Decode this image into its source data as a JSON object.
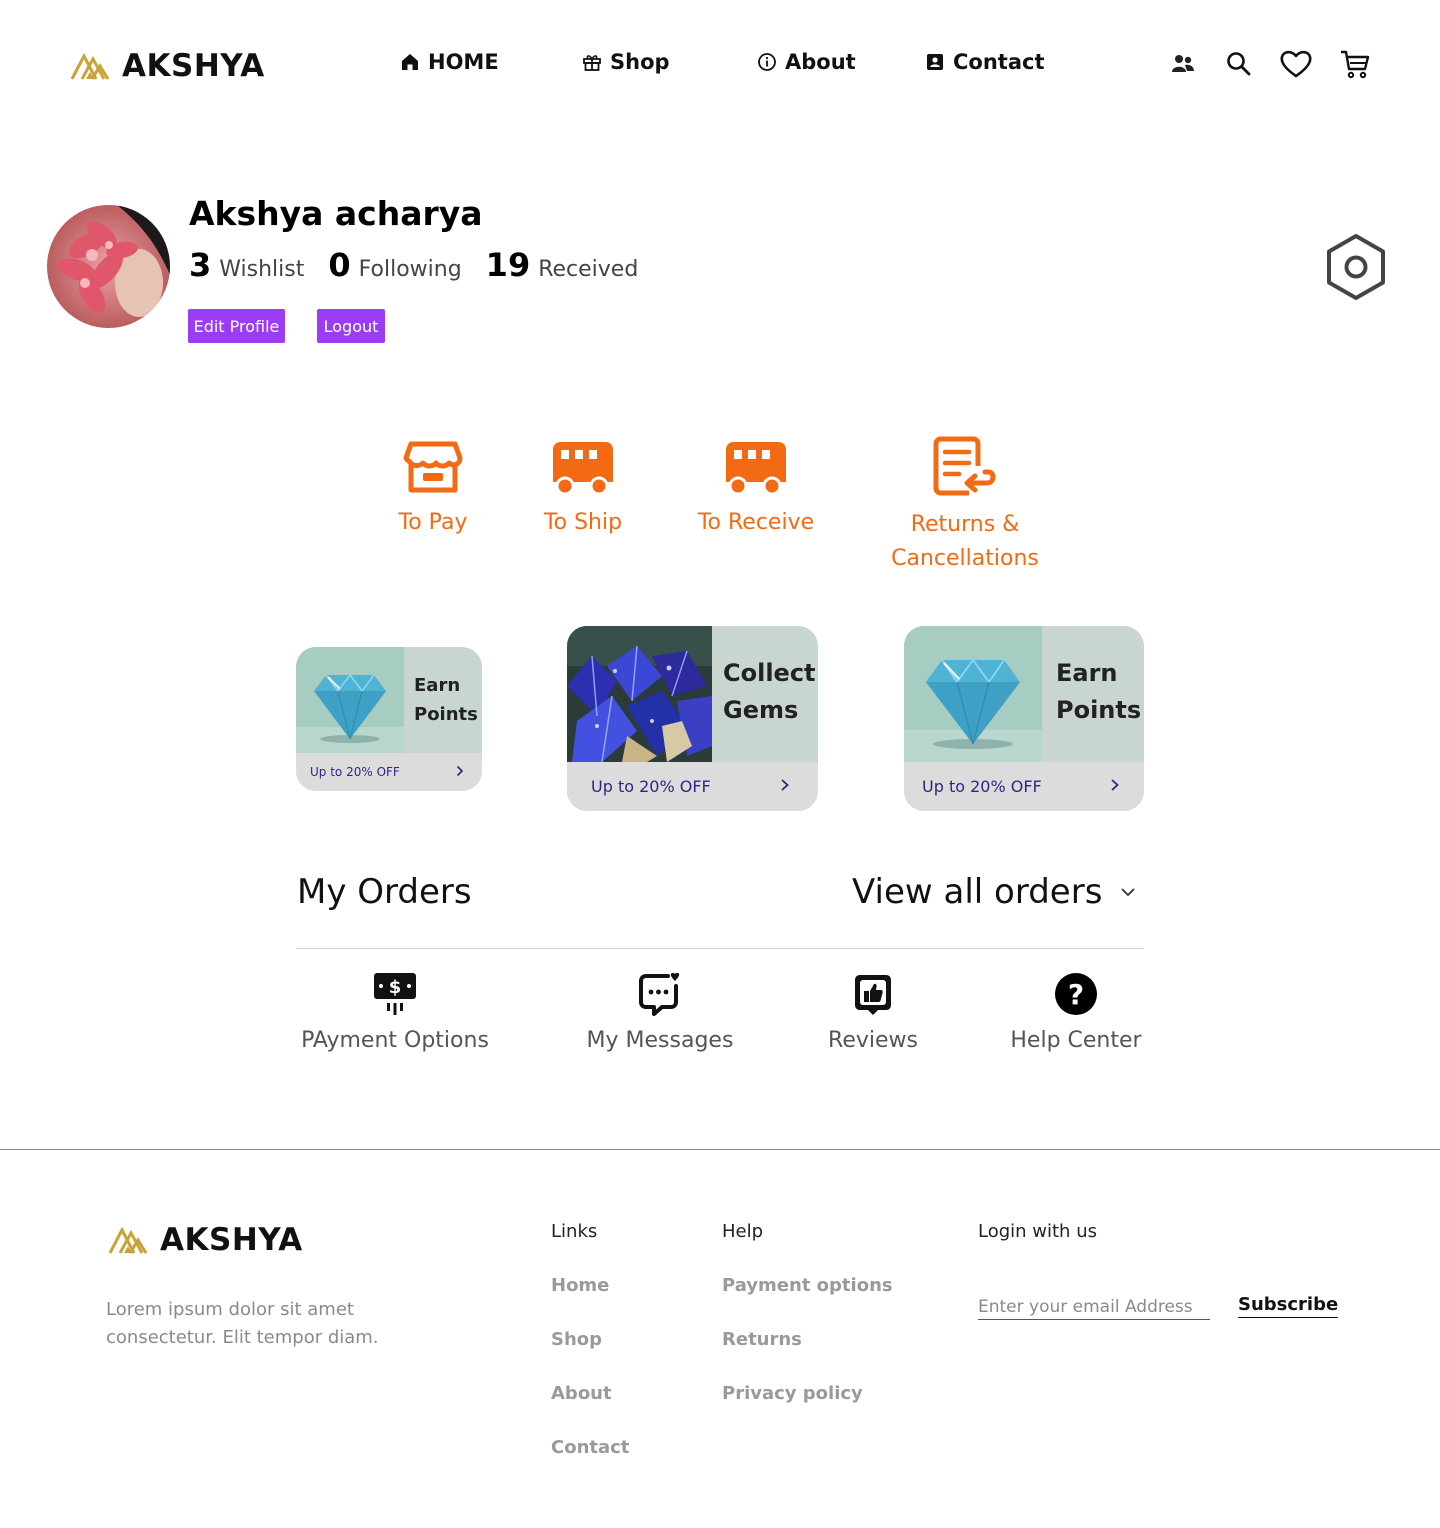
{
  "brand": {
    "name": "AKSHYA",
    "gold": "#c9a338"
  },
  "nav": {
    "home": "HOME",
    "shop": "Shop",
    "about": "About",
    "contact": "Contact"
  },
  "header_icons": [
    "users-icon",
    "search-icon",
    "heart-icon",
    "cart-icon"
  ],
  "profile": {
    "name": "Akshya acharya",
    "stats": [
      {
        "value": "3",
        "label": "Wishlist"
      },
      {
        "value": "0",
        "label": "Following"
      },
      {
        "value": "19",
        "label": "Received"
      }
    ],
    "edit_label": "Edit Profile",
    "logout_label": "Logout",
    "button_color": "#9b3cf2"
  },
  "order_status": {
    "accent": "#f26a14",
    "items": [
      {
        "label": "To Pay",
        "icon": "store-icon"
      },
      {
        "label": "To Ship",
        "icon": "truck-icon"
      },
      {
        "label": "To Receive",
        "icon": "truck-icon"
      },
      {
        "label_line1": "Returns &",
        "label_line2": "Cancellations",
        "icon": "return-document-icon"
      }
    ]
  },
  "promos": [
    {
      "title_line1": "Earn",
      "title_line2": "Points",
      "offer": "Up to 20% OFF",
      "image": "diamond-image"
    },
    {
      "title_line1": "Collect",
      "title_line2": "Gems",
      "offer": "Up to 20% OFF",
      "image": "gems-image"
    },
    {
      "title_line1": "Earn",
      "title_line2": "Points",
      "offer": "Up to 20% OFF",
      "image": "diamond-image"
    }
  ],
  "orders": {
    "title": "My Orders",
    "view_all": "View all orders",
    "services": [
      {
        "label": "PAyment Options",
        "icon": "payment-icon"
      },
      {
        "label": "My Messages",
        "icon": "message-icon"
      },
      {
        "label": "Reviews",
        "icon": "review-icon"
      },
      {
        "label": "Help Center",
        "icon": "help-icon"
      }
    ]
  },
  "footer": {
    "description": "Lorem ipsum dolor sit amet consectetur. Elit tempor diam.",
    "links_title": "Links",
    "links": [
      "Home",
      "Shop",
      "About",
      "Contact"
    ],
    "help_title": "Help",
    "help_links": [
      "Payment options",
      "Returns",
      "Privacy policy"
    ],
    "login_title": "Login with us",
    "email_placeholder": "Enter your email Address",
    "subscribe_label": "Subscribe"
  }
}
